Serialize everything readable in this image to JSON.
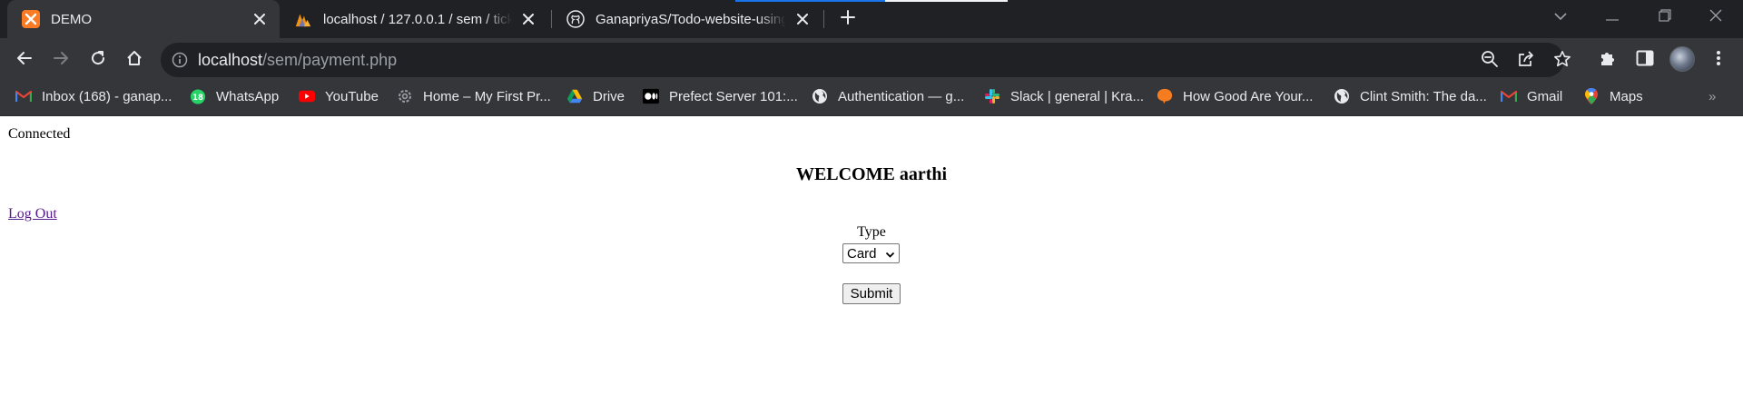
{
  "tabs": [
    {
      "title": "DEMO",
      "icon": "xampp-icon",
      "active": true
    },
    {
      "title": "localhost / 127.0.0.1 / sem / ticke",
      "icon": "phpmyadmin-icon",
      "active": false
    },
    {
      "title": "GanapriyaS/Todo-website-using-",
      "icon": "github-icon",
      "active": false
    }
  ],
  "loading_progress": 0.55,
  "address_bar": {
    "host": "localhost",
    "path": "/sem/payment.php"
  },
  "bookmarks": [
    {
      "label": "Inbox (168) - ganap...",
      "icon": "gmail-icon"
    },
    {
      "label": "WhatsApp",
      "icon": "whatsapp-icon",
      "badge": "18"
    },
    {
      "label": "YouTube",
      "icon": "youtube-icon"
    },
    {
      "label": "Home – My First Pr...",
      "icon": "wordpress-icon"
    },
    {
      "label": "Drive",
      "icon": "google-drive-icon"
    },
    {
      "label": "Prefect Server 101:...",
      "icon": "medium-icon"
    },
    {
      "label": "Authentication — g...",
      "icon": "globe-icon"
    },
    {
      "label": "Slack | general | Kra...",
      "icon": "slack-icon"
    },
    {
      "label": "How Good Are Your...",
      "icon": "orange-blob-icon"
    },
    {
      "label": "Clint Smith: The da...",
      "icon": "globe-icon"
    },
    {
      "label": "Gmail",
      "icon": "gmail-icon"
    },
    {
      "label": "Maps",
      "icon": "google-maps-icon"
    }
  ],
  "bookmarks_overflow": "»",
  "page": {
    "status": "Connected",
    "welcome": "WELCOME aarthi",
    "logout": "Log Out",
    "type_label": "Type",
    "type_selected": "Card",
    "submit_label": "Submit"
  },
  "colors": {
    "tabstrip_bg": "#202124",
    "toolbar_bg": "#35363a",
    "omnibox_bg": "#202124",
    "link_visited": "#551a8b"
  }
}
